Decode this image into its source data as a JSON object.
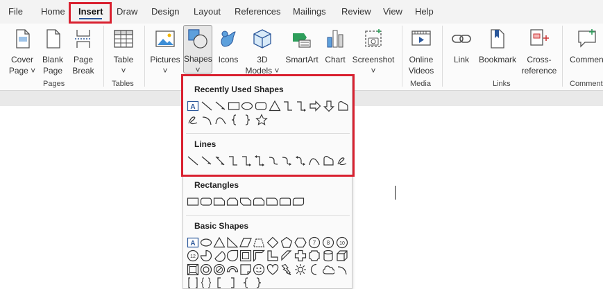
{
  "menu": {
    "tabs": [
      {
        "label": "File"
      },
      {
        "label": "Home"
      },
      {
        "label": "Insert"
      },
      {
        "label": "Draw"
      },
      {
        "label": "Design"
      },
      {
        "label": "Layout"
      },
      {
        "label": "References"
      },
      {
        "label": "Mailings"
      },
      {
        "label": "Review"
      },
      {
        "label": "View"
      },
      {
        "label": "Help"
      }
    ],
    "active": "Insert"
  },
  "ribbon": {
    "buttons": {
      "cover_page": "Cover\nPage ˅",
      "blank_page": "Blank\nPage",
      "page_break": "Page\nBreak",
      "table": "Table\n˅",
      "pictures": "Pictures\n˅",
      "shapes": "Shapes\n˅",
      "icons": "Icons",
      "models_3d": "3D\nModels ˅",
      "smartart": "SmartArt",
      "chart": "Chart",
      "screenshot": "Screenshot\n˅",
      "online_videos": "Online\nVideos",
      "link": "Link",
      "bookmark": "Bookmark",
      "cross_reference": "Cross-\nreference",
      "comment": "Commen"
    },
    "groups": {
      "pages": "Pages",
      "tables": "Tables",
      "media": "Media",
      "links": "Links",
      "comments": "Comment"
    }
  },
  "shapes_menu": {
    "sections": {
      "recently_used": "Recently Used Shapes",
      "lines": "Lines",
      "rectangles": "Rectangles",
      "basic_shapes": "Basic Shapes"
    }
  },
  "colors": {
    "highlight": "#d9202f",
    "accent": "#2b579a"
  }
}
